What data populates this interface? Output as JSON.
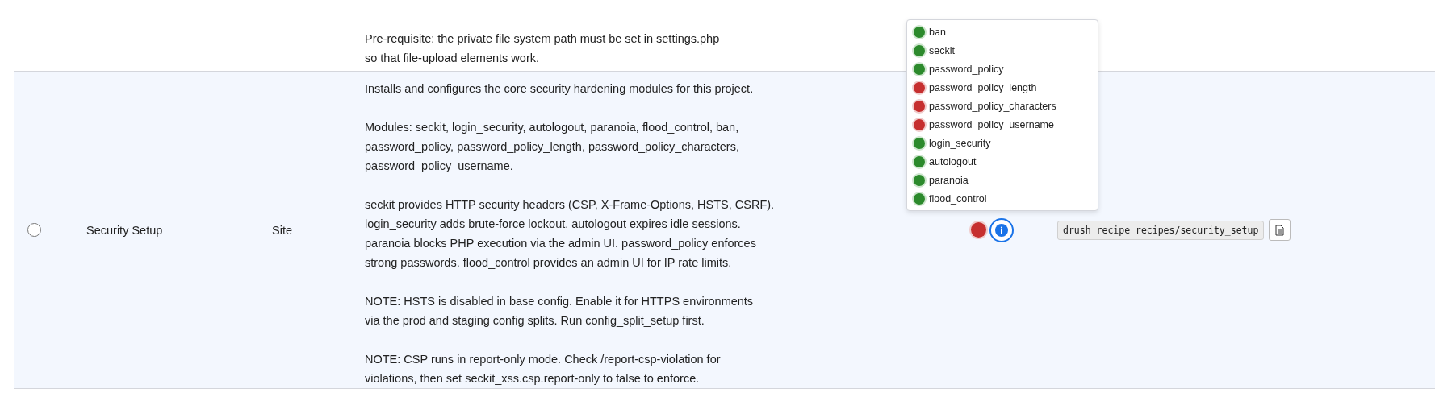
{
  "rows": [
    {
      "description": [
        [
          "Pre-requisite: the private file system path must be set in settings.php",
          "so that file-upload elements work."
        ]
      ]
    },
    {
      "selected": false,
      "name": "Security Setup",
      "type": "Site",
      "description": [
        [
          "Installs and configures the core security hardening modules for this project."
        ],
        [
          "Modules: seckit, login_security, autologout, paranoia, flood_control, ban,",
          "password_policy, password_policy_length, password_policy_characters,",
          "password_policy_username."
        ],
        [
          "seckit provides HTTP security headers (CSP, X-Frame-Options, HSTS, CSRF).",
          "login_security adds brute-force lockout. autologout expires idle sessions.",
          "paranoia blocks PHP execution via the admin UI. password_policy enforces",
          "strong passwords. flood_control provides an admin UI for IP rate limits."
        ],
        [
          "NOTE: HSTS is disabled in base config. Enable it for HTTPS environments",
          "via the prod and staging config splits. Run config_split_setup first."
        ],
        [
          "NOTE: CSP runs in report-only mode. Check /report-csp-violation for",
          "violations, then set seckit_xss.csp.report-only to false to enforce."
        ]
      ],
      "ok": false,
      "details_expanded": true,
      "modules": [
        {
          "name": "ban",
          "ok": true
        },
        {
          "name": "seckit",
          "ok": true
        },
        {
          "name": "password_policy",
          "ok": true
        },
        {
          "name": "password_policy_length",
          "ok": false
        },
        {
          "name": "password_policy_characters",
          "ok": false
        },
        {
          "name": "password_policy_username",
          "ok": false
        },
        {
          "name": "login_security",
          "ok": true
        },
        {
          "name": "autologout",
          "ok": true
        },
        {
          "name": "paranoia",
          "ok": true
        },
        {
          "name": "flood_control",
          "ok": true
        }
      ],
      "command": "drush recipe recipes/security_setup"
    }
  ]
}
